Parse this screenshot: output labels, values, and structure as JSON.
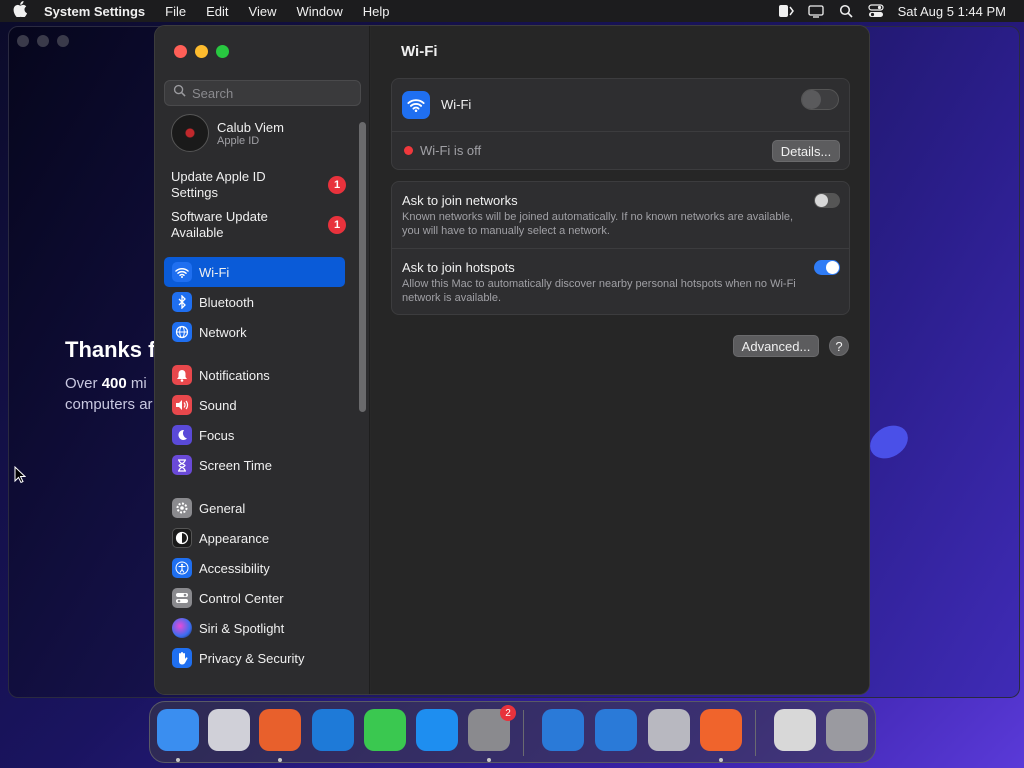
{
  "menubar": {
    "app_name": "System Settings",
    "items": [
      "File",
      "Edit",
      "View",
      "Window",
      "Help"
    ],
    "clock": "Sat Aug 5  1:44 PM"
  },
  "background_app": {
    "heading": "Thanks f",
    "sub_pre": "Over ",
    "sub_bold": "400",
    "sub_post": " mi",
    "sub_line2": "computers ar"
  },
  "sidebar": {
    "search_placeholder": "Search",
    "account": {
      "name": "Calub Viem",
      "subtitle": "Apple ID"
    },
    "notices": [
      {
        "label": "Update Apple ID Settings",
        "badge": "1"
      },
      {
        "label": "Software Update Available",
        "badge": "1"
      }
    ],
    "items": [
      {
        "label": "Wi-Fi",
        "icon": "wifi-icon",
        "color": "#1f6ff0"
      },
      {
        "label": "Bluetooth",
        "icon": "bluetooth-icon",
        "color": "#1f6ff0"
      },
      {
        "label": "Network",
        "icon": "globe-icon",
        "color": "#1f6ff0"
      },
      {
        "label": "Notifications",
        "icon": "bell-icon",
        "color": "#e8484c"
      },
      {
        "label": "Sound",
        "icon": "speaker-icon",
        "color": "#e8484c"
      },
      {
        "label": "Focus",
        "icon": "moon-icon",
        "color": "#5a4ad8"
      },
      {
        "label": "Screen Time",
        "icon": "hourglass-icon",
        "color": "#6a4ad8"
      },
      {
        "label": "General",
        "icon": "gear-icon",
        "color": "#8a8a8e"
      },
      {
        "label": "Appearance",
        "icon": "appearance-icon",
        "color": "#1a1a1a"
      },
      {
        "label": "Accessibility",
        "icon": "accessibility-icon",
        "color": "#1f6ff0"
      },
      {
        "label": "Control Center",
        "icon": "control-center-icon",
        "color": "#8a8a8e"
      },
      {
        "label": "Siri & Spotlight",
        "icon": "siri-icon",
        "color": "#b04ad8"
      },
      {
        "label": "Privacy & Security",
        "icon": "hand-icon",
        "color": "#1f6ff0"
      }
    ]
  },
  "main": {
    "title": "Wi-Fi",
    "wifi_label": "Wi-Fi",
    "wifi_on": false,
    "status_text": "Wi-Fi is off",
    "details_button": "Details...",
    "ask_networks": {
      "title": "Ask to join networks",
      "desc": "Known networks will be joined automatically. If no known networks are available, you will have to manually select a network.",
      "on": false
    },
    "ask_hotspots": {
      "title": "Ask to join hotspots",
      "desc": "Allow this Mac to automatically discover nearby personal hotspots when no Wi-Fi network is available.",
      "on": true
    },
    "advanced_button": "Advanced...",
    "help_button": "?"
  },
  "dock": {
    "items": [
      {
        "name": "finder-icon",
        "color": "#3a8ef0",
        "running": true
      },
      {
        "name": "launchpad-icon",
        "color": "#d0d0d8",
        "running": false
      },
      {
        "name": "firefox-icon",
        "color": "#e8602c",
        "running": true
      },
      {
        "name": "vscode-icon",
        "color": "#1e7ad8",
        "running": false
      },
      {
        "name": "messages-icon",
        "color": "#3ac850",
        "running": false
      },
      {
        "name": "app-store-icon",
        "color": "#1e8ef0",
        "running": false
      },
      {
        "name": "system-settings-icon",
        "color": "#8a8a8e",
        "running": true,
        "badge": "2"
      },
      {
        "name": "xcode-icon",
        "color": "#2a7ad8",
        "running": false
      },
      {
        "name": "simulator-icon",
        "color": "#2a7ad8",
        "running": false
      },
      {
        "name": "installer-icon",
        "color": "#b8b8c0",
        "running": false
      },
      {
        "name": "swift-icon",
        "color": "#f0642c",
        "running": true
      },
      {
        "name": "documents-icon",
        "color": "#d8d8d8",
        "running": false
      },
      {
        "name": "trash-icon",
        "color": "#9a9aa0",
        "running": false
      }
    ]
  }
}
